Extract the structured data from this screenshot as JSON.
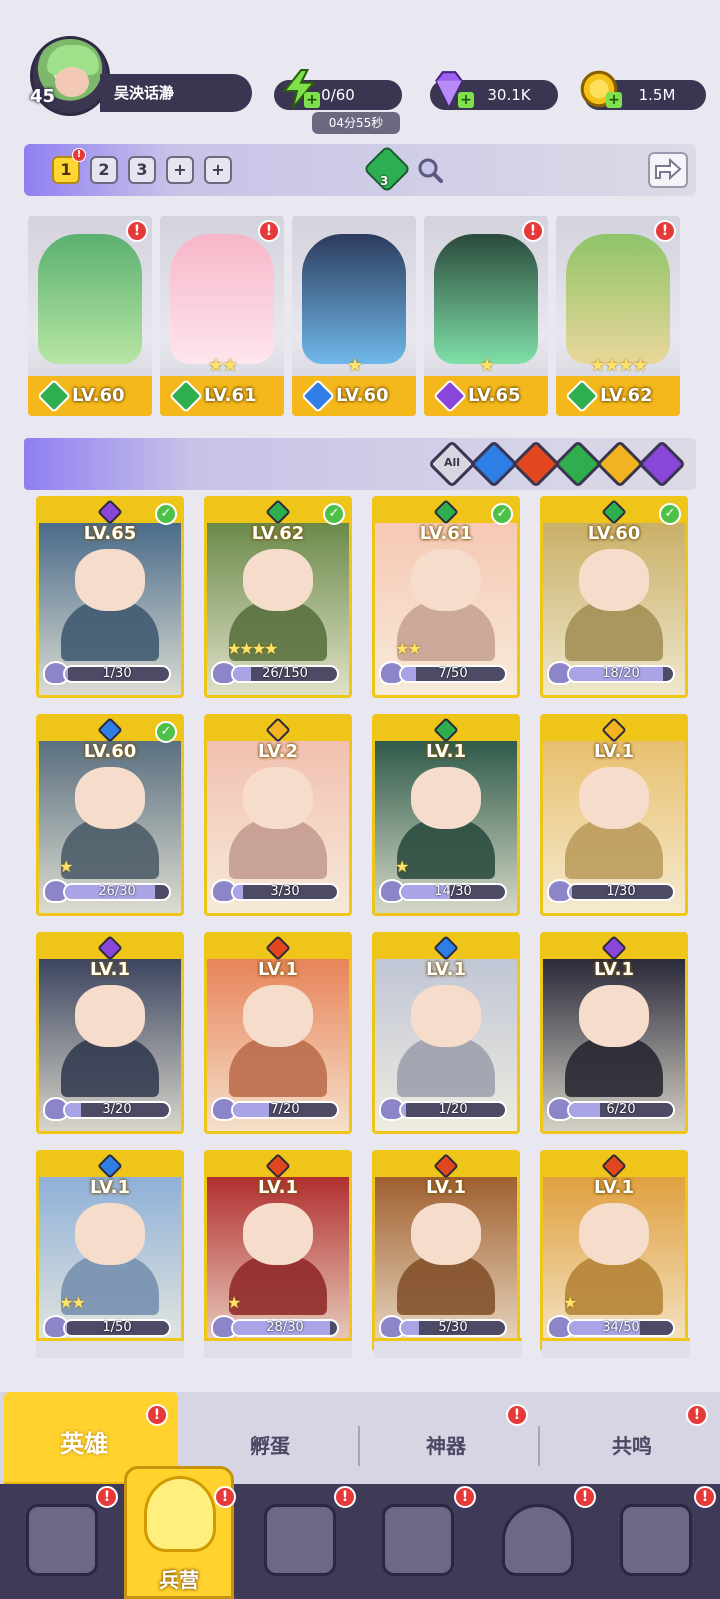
{
  "player": {
    "level": "45",
    "name": "吴泱话瀞"
  },
  "resources": {
    "energy": {
      "value": "0/60",
      "timer": "04分55秒",
      "icon": "lightning-icon",
      "color": "#7ee04a"
    },
    "gems": {
      "value": "30.1K",
      "icon": "diamond-icon",
      "color": "#9b62f2"
    },
    "gold": {
      "value": "1.5M",
      "icon": "coin-icon",
      "color": "#f4c21a"
    }
  },
  "team": {
    "tabs": [
      "1",
      "2",
      "3",
      "+",
      "+"
    ],
    "active_tab": "1",
    "gem_count": "3",
    "cards": [
      {
        "level": "LV.60",
        "stars": "",
        "element": "nature",
        "alert": "!"
      },
      {
        "level": "LV.61",
        "stars": "★★",
        "element": "nature",
        "alert": "!"
      },
      {
        "level": "LV.60",
        "stars": "★",
        "element": "water",
        "alert": ""
      },
      {
        "level": "LV.65",
        "stars": "★",
        "element": "dark",
        "alert": "!"
      },
      {
        "level": "LV.62",
        "stars": "★★★★",
        "element": "nature",
        "alert": "!"
      }
    ]
  },
  "filters": {
    "all_label": "All",
    "elements": [
      "water",
      "fire",
      "nature",
      "light",
      "dark"
    ]
  },
  "element_colors": {
    "water": "#2f7ee6",
    "fire": "#e2461f",
    "nature": "#2fae4e",
    "light": "#f2b320",
    "dark": "#8a45d9"
  },
  "heroes": [
    {
      "level": "LV.65",
      "element": "dark",
      "progress": "1/30",
      "fill": 0.03,
      "stars": "",
      "owned": true
    },
    {
      "level": "LV.62",
      "element": "nature",
      "progress": "26/150",
      "fill": 0.17,
      "stars": "★★★★",
      "owned": true
    },
    {
      "level": "LV.61",
      "element": "nature",
      "progress": "7/50",
      "fill": 0.14,
      "stars": "★★",
      "owned": true
    },
    {
      "level": "LV.60",
      "element": "nature",
      "progress": "18/20",
      "fill": 0.9,
      "stars": "",
      "owned": true
    },
    {
      "level": "LV.60",
      "element": "water",
      "progress": "26/30",
      "fill": 0.87,
      "stars": "★",
      "owned": true
    },
    {
      "level": "LV.2",
      "element": "light",
      "progress": "3/30",
      "fill": 0.1,
      "stars": "",
      "owned": false
    },
    {
      "level": "LV.1",
      "element": "nature",
      "progress": "14/30",
      "fill": 0.47,
      "stars": "★",
      "owned": false
    },
    {
      "level": "LV.1",
      "element": "light",
      "progress": "1/30",
      "fill": 0.03,
      "stars": "",
      "owned": false
    },
    {
      "level": "LV.1",
      "element": "dark",
      "progress": "3/20",
      "fill": 0.15,
      "stars": "",
      "owned": false
    },
    {
      "level": "LV.1",
      "element": "fire",
      "progress": "7/20",
      "fill": 0.35,
      "stars": "",
      "owned": false
    },
    {
      "level": "LV.1",
      "element": "water",
      "progress": "1/20",
      "fill": 0.05,
      "stars": "",
      "owned": false
    },
    {
      "level": "LV.1",
      "element": "dark",
      "progress": "6/20",
      "fill": 0.3,
      "stars": "",
      "owned": false
    },
    {
      "level": "LV.1",
      "element": "water",
      "progress": "1/50",
      "fill": 0.02,
      "stars": "★★",
      "owned": false
    },
    {
      "level": "LV.1",
      "element": "fire",
      "progress": "28/30",
      "fill": 0.93,
      "stars": "★",
      "owned": false
    },
    {
      "level": "LV.1",
      "element": "fire",
      "progress": "5/30",
      "fill": 0.17,
      "stars": "",
      "owned": false
    },
    {
      "level": "LV.1",
      "element": "fire",
      "progress": "34/50",
      "fill": 0.68,
      "stars": "★",
      "owned": false
    }
  ],
  "subtabs": [
    "英雄",
    "孵蛋",
    "神器",
    "共鸣"
  ],
  "nav": {
    "items": [
      "cards-icon",
      "barracks-icon",
      "book-icon",
      "castle-icon",
      "mushroom-icon",
      "banner-icon"
    ],
    "active_label": "兵营"
  },
  "alert_mark": "!"
}
